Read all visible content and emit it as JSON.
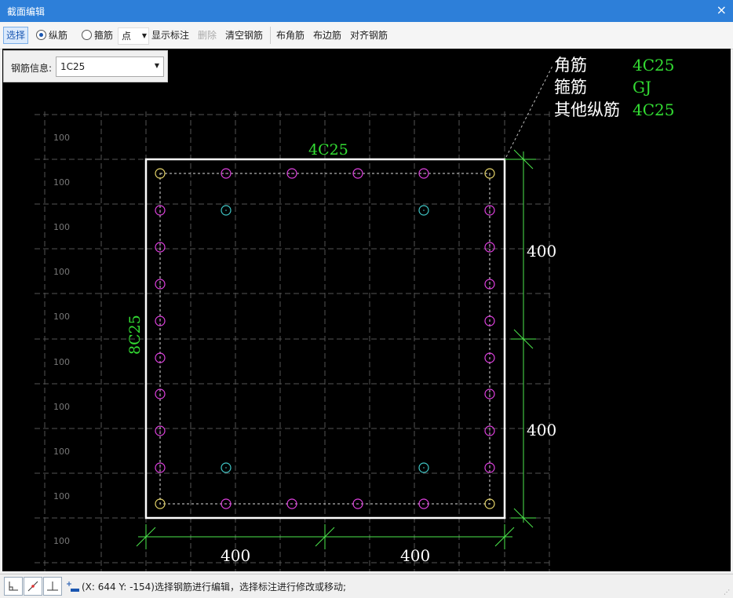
{
  "window": {
    "title": "截面编辑",
    "close": "×"
  },
  "toolbar": {
    "select": "选择",
    "longitudinal": "纵筋",
    "stirrup": "箍筋",
    "point_mode": "点",
    "show_annotation": "显示标注",
    "delete": "删除",
    "clear_rebar": "清空钢筋",
    "corner_rebar": "布角筋",
    "edge_rebar": "布边筋",
    "align_rebar": "对齐钢筋"
  },
  "rebar_info": {
    "label": "钢筋信息:",
    "value": "1C25"
  },
  "legend": {
    "corner_label": "角筋",
    "corner_value": "4C25",
    "stirrup_label": "箍筋",
    "stirrup_value": "GJ",
    "other_label": "其他纵筋",
    "other_value": "4C25"
  },
  "section": {
    "top_annotation": "4C25",
    "side_annotation": "8C25",
    "dim_right_top": "400",
    "dim_right_bottom": "400",
    "dim_bottom_left": "400",
    "dim_bottom_right": "400"
  },
  "grid_label": "100",
  "status": {
    "text": "(X: 644 Y: -154)选择钢筋进行编辑，选择标注进行修改或移动;"
  },
  "colors": {
    "corner": "#e8d66a",
    "edge": "#e040e0",
    "inner": "#40c8c8",
    "annotation": "#33dd33",
    "dimension": "#4ce84c"
  }
}
